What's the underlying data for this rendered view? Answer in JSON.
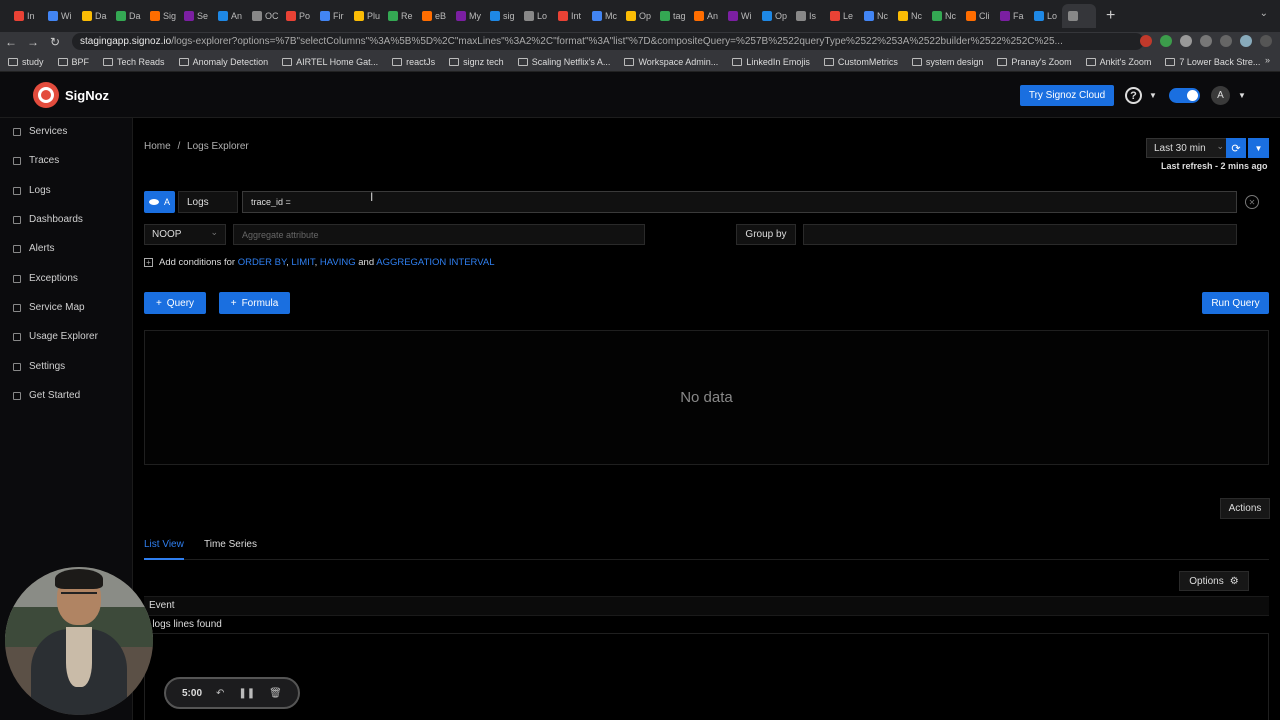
{
  "browser": {
    "tabs": [
      "In",
      "Wi",
      "Da",
      "Da",
      "Sig",
      "Se",
      "An",
      "OC",
      "Po",
      "Fir",
      "Plu",
      "Re",
      "eB",
      "My",
      "sig",
      "Lo",
      "Int",
      "Mc",
      "Op",
      "tag",
      "An",
      "Wi",
      "Op",
      "Is",
      "Le",
      "Nc",
      "Nc",
      "Nc",
      "Cli",
      "Fa",
      "Lo",
      ""
    ],
    "url_host": "stagingapp.signoz.io",
    "url_path": "/logs-explorer?options=%7B\"selectColumns\"%3A%5B%5D%2C\"maxLines\"%3A2%2C\"format\"%3A\"list\"%7D&compositeQuery=%257B%2522queryType%2522%253A%2522builder%2522%252C%25...",
    "bookmarks": [
      "study",
      "BPF",
      "Tech Reads",
      "Anomaly Detection",
      "AIRTEL Home Gat...",
      "reactJs",
      "signz tech",
      "Scaling Netflix's A...",
      "Workspace Admin...",
      "LinkedIn Emojis",
      "CustomMetrics",
      "system design",
      "Pranay's Zoom",
      "Ankit's Zoom",
      "7 Lower Back Stre..."
    ]
  },
  "header": {
    "brand": "SigNoz",
    "try_cloud": "Try Signoz Cloud",
    "help": "?",
    "avatar_initial": "A"
  },
  "sidebar": {
    "items": [
      {
        "label": "Services",
        "icon": "bar-chart-icon"
      },
      {
        "label": "Traces",
        "icon": "list-icon"
      },
      {
        "label": "Logs",
        "icon": "logs-icon"
      },
      {
        "label": "Dashboards",
        "icon": "dashboard-icon"
      },
      {
        "label": "Alerts",
        "icon": "alert-icon"
      },
      {
        "label": "Exceptions",
        "icon": "bug-icon"
      },
      {
        "label": "Service Map",
        "icon": "map-icon"
      },
      {
        "label": "Usage Explorer",
        "icon": "usage-icon"
      },
      {
        "label": "Settings",
        "icon": "settings-icon"
      },
      {
        "label": "Get Started",
        "icon": "rocket-icon"
      }
    ]
  },
  "breadcrumb": {
    "home": "Home",
    "separator": "/",
    "current": "Logs Explorer"
  },
  "time": {
    "range": "Last 30 min",
    "last_refresh": "Last refresh - 2 mins ago"
  },
  "query": {
    "label": "A",
    "source": "Logs",
    "search_value": "trace_id =",
    "aggregate_op": "NOOP",
    "aggregate_placeholder": "Aggregate attribute",
    "group_by": "Group by",
    "add_conditions_prefix": "Add conditions for",
    "order_by": "ORDER BY",
    "comma": ",",
    "limit": "LIMIT",
    "having": "HAVING",
    "and": "and",
    "agg_interval": "AGGREGATION INTERVAL"
  },
  "buttons": {
    "query": "Query",
    "formula": "Formula",
    "run_query": "Run Query",
    "actions": "Actions",
    "options": "Options"
  },
  "chart": {
    "empty_text": "No data"
  },
  "views": {
    "list_view": "List View",
    "time_series": "Time Series"
  },
  "logs": {
    "event_header": "Event",
    "empty_text": "o logs lines found"
  },
  "recorder": {
    "time": "5:00"
  },
  "colors": {
    "accent": "#1a6fe0",
    "link": "#2f7ff0",
    "logo": "#e34c3d"
  }
}
